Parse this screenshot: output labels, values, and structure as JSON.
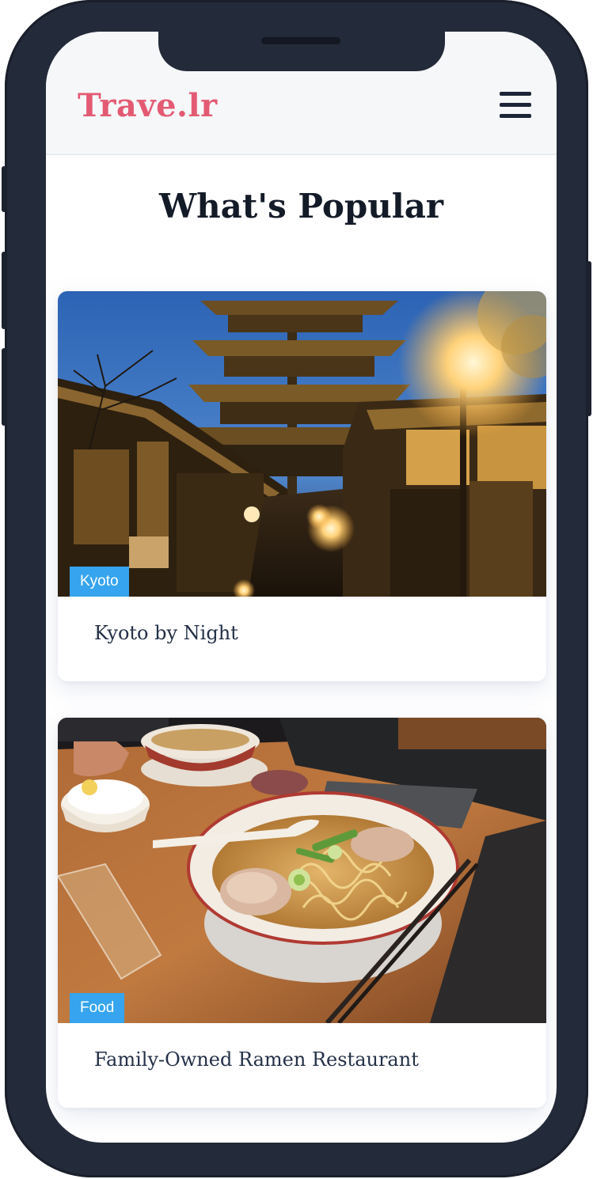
{
  "app": {
    "logo": "Trave.lr"
  },
  "header": {
    "menu_icon": "hamburger-menu-icon"
  },
  "main": {
    "title": "What's Popular",
    "cards": [
      {
        "tag": "Kyoto",
        "title": "Kyoto by Night",
        "image": "kyoto-pagoda-night-photo"
      },
      {
        "tag": "Food",
        "title": "Family-Owned Ramen Restaurant",
        "image": "ramen-bowl-photo"
      }
    ]
  },
  "colors": {
    "brand": "#e35b73",
    "badge": "#36a4ee",
    "heading": "#141b28",
    "card_title": "#243048",
    "device_frame": "#232a39"
  }
}
